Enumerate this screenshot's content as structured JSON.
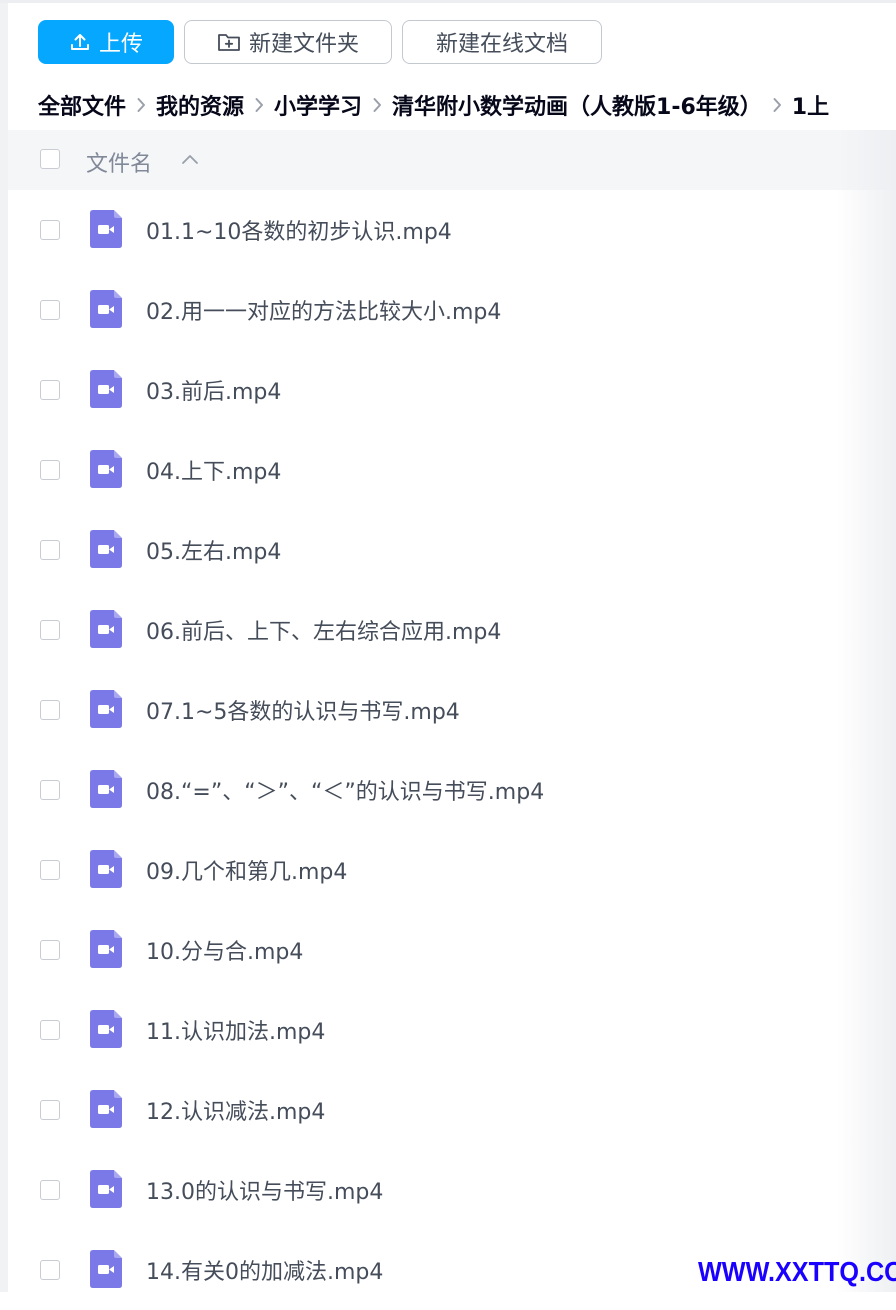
{
  "toolbar": {
    "upload_label": "上传",
    "new_folder_label": "新建文件夹",
    "new_online_doc_label": "新建在线文档"
  },
  "breadcrumb": [
    "全部文件",
    "我的资源",
    "小学学习",
    "清华附小数学动画（人教版1-6年级）",
    "1上"
  ],
  "table": {
    "header_label": "文件名"
  },
  "files": [
    {
      "name": "01.1~10各数的初步认识.mp4"
    },
    {
      "name": "02.用一一对应的方法比较大小.mp4"
    },
    {
      "name": "03.前后.mp4"
    },
    {
      "name": "04.上下.mp4"
    },
    {
      "name": "05.左右.mp4"
    },
    {
      "name": "06.前后、上下、左右综合应用.mp4"
    },
    {
      "name": "07.1~5各数的认识与书写.mp4"
    },
    {
      "name": "08.“=”、“＞”、“＜”的认识与书写.mp4"
    },
    {
      "name": "09.几个和第几.mp4"
    },
    {
      "name": "10.分与合.mp4"
    },
    {
      "name": "11.认识加法.mp4"
    },
    {
      "name": "12.认识减法.mp4"
    },
    {
      "name": "13.0的认识与书写.mp4"
    },
    {
      "name": "14.有关0的加减法.mp4"
    }
  ],
  "watermark": "WWW.XXTTQ.COM",
  "colors": {
    "primary": "#06a7ff",
    "video_icon": "#7b78e8",
    "watermark": "#1a00ff"
  },
  "icons": {
    "upload": "upload-icon",
    "new_folder": "folder-plus-icon",
    "breadcrumb_separator": "chevron-right-icon",
    "sort": "chevron-up-icon",
    "file": "video-file-icon"
  }
}
